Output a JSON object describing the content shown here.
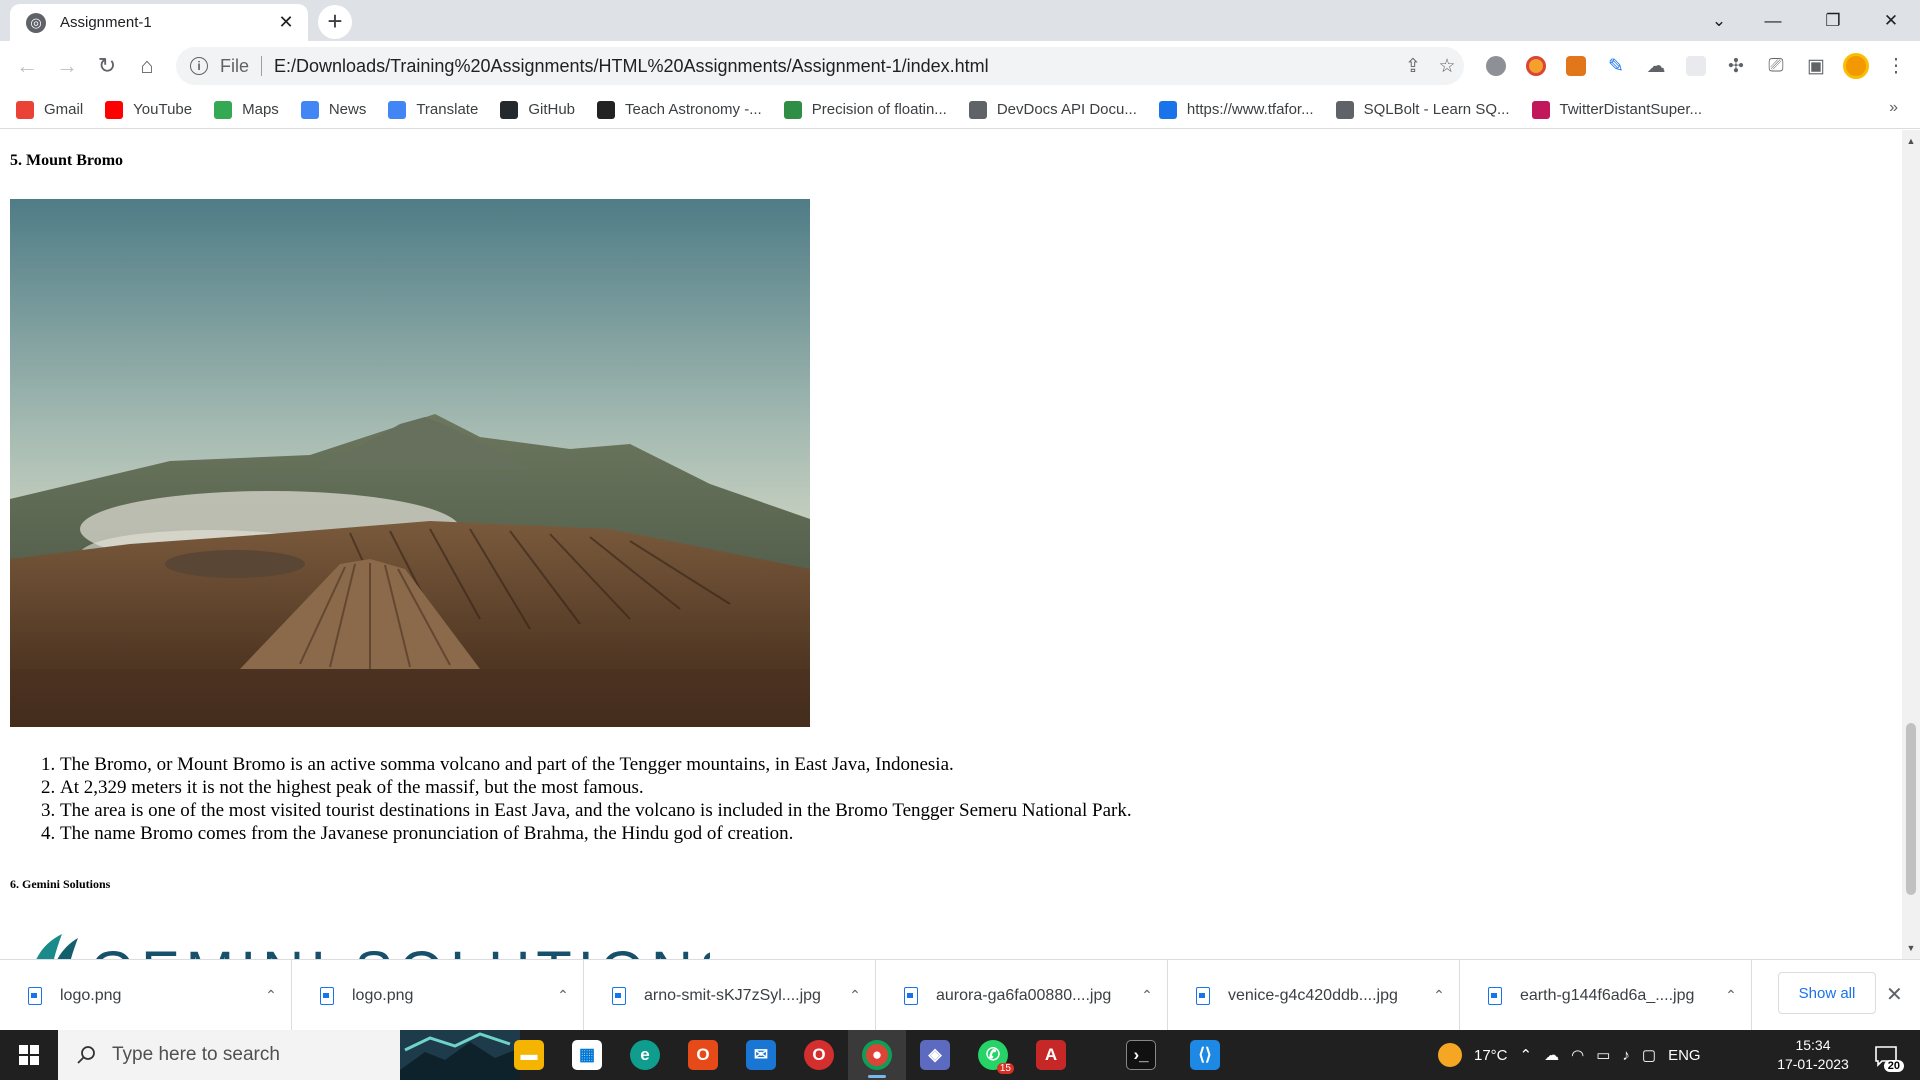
{
  "browser": {
    "tab_title": "Assignment-1",
    "omnibox": {
      "scheme_label": "File",
      "url": "E:/Downloads/Training%20Assignments/HTML%20Assignments/Assignment-1/index.html"
    },
    "bookmarks": [
      {
        "label": "Gmail",
        "icon": "gmail-icon",
        "color": "#ea4335"
      },
      {
        "label": "YouTube",
        "icon": "youtube-icon",
        "color": "#ff0000"
      },
      {
        "label": "Maps",
        "icon": "maps-icon",
        "color": "#34a853"
      },
      {
        "label": "News",
        "icon": "news-icon",
        "color": "#4285f4"
      },
      {
        "label": "Translate",
        "icon": "translate-icon",
        "color": "#4285f4"
      },
      {
        "label": "GitHub",
        "icon": "github-icon",
        "color": "#24292e"
      },
      {
        "label": "Teach Astronomy -...",
        "icon": "astronomy-icon",
        "color": "#222222"
      },
      {
        "label": "Precision of floatin...",
        "icon": "geeks-icon",
        "color": "#2f8d46"
      },
      {
        "label": "DevDocs API Docu...",
        "icon": "devdocs-icon",
        "color": "#5f6368"
      },
      {
        "label": "https://www.tfafor...",
        "icon": "tfa-icon",
        "color": "#1a73e8"
      },
      {
        "label": "SQLBolt - Learn SQ...",
        "icon": "database-icon",
        "color": "#5f6368"
      },
      {
        "label": "TwitterDistantSuper...",
        "icon": "s-icon",
        "color": "#c2185b"
      }
    ]
  },
  "page": {
    "heading_5": "5. Mount Bromo",
    "facts": [
      "The Bromo, or Mount Bromo is an active somma volcano and part of the Tengger mountains, in East Java, Indonesia.",
      "At 2,329 meters it is not the highest peak of the massif, but the most famous.",
      "The area is one of the most visited tourist destinations in East Java, and the volcano is included in the Bromo Tengger Semeru National Park.",
      "The name Bromo comes from the Javanese pronunciation of Brahma, the Hindu god of creation."
    ],
    "heading_6": "6. Gemini Solutions",
    "logo_text": "GEMINI SOLUTIONS"
  },
  "downloads": {
    "items": [
      "logo.png",
      "logo.png",
      "arno-smit-sKJ7zSyl....jpg",
      "aurora-ga6fa00880....jpg",
      "venice-g4c420ddb....jpg",
      "earth-g144f6ad6a_....jpg"
    ],
    "show_all_label": "Show all"
  },
  "taskbar": {
    "search_placeholder": "Type here to search",
    "weather": "17°C",
    "language": "ENG",
    "time": "15:34",
    "date": "17-01-2023",
    "whatsapp_badge": "15",
    "notification_count": "20"
  },
  "colors": {
    "accent": "#1a73e8",
    "tabstrip": "#dee1e6",
    "taskbar": "#202020"
  }
}
